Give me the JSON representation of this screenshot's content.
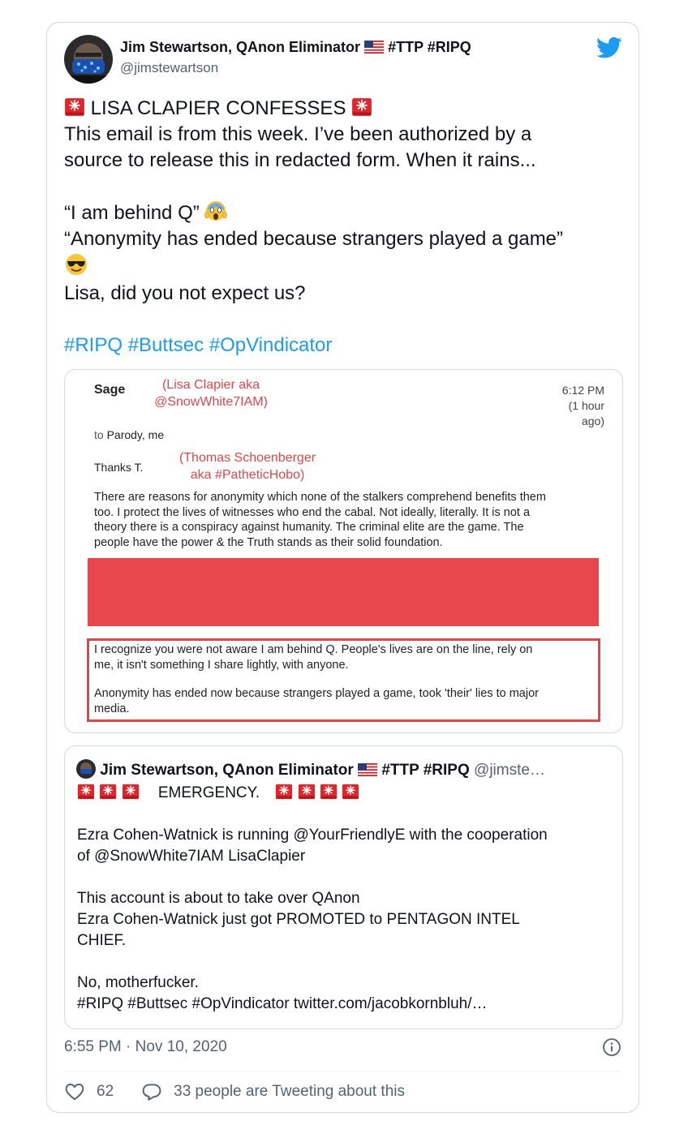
{
  "tweet": {
    "author_name": "Jim Stewartson, QAnon Eliminator",
    "name_suffix": "#TTP #RIPQ",
    "handle": "@jimstewartson",
    "title_line": "LISA CLAPIER CONFESSES",
    "body_lines": [
      "This email is from this week. I’ve been authorized by a",
      "source to release this in redacted form. When it rains..."
    ],
    "quote1": "“I am behind Q”",
    "quote2": "“Anonymity has ended because strangers played a game”",
    "closing": "Lisa, did you not expect us?",
    "hashtags": "#RIPQ #Buttsec #OpVindicator",
    "timestamp": "6:55 PM · Nov 10, 2020",
    "likes": "62",
    "retweet_text": "33 people are Tweeting about this"
  },
  "email": {
    "sender": "Sage",
    "sender_annotation_1": "(Lisa Clapier aka",
    "sender_annotation_2": "@SnowWhite7IAM)",
    "time": "6:12 PM",
    "ago_1": "(1 hour",
    "ago_2": "ago)",
    "to_prefix": "to",
    "to_names": "Parody, me",
    "greeting": "Thanks T.",
    "greeting_annotation_1": "(Thomas Schoenberger",
    "greeting_annotation_2": "aka #PatheticHobo)",
    "para1": [
      "There are reasons for anonymity which none of the stalkers comprehend benefits them",
      "too. I protect the lives of witnesses who end the cabal. Not ideally, literally. It is not a",
      "theory there is a conspiracy against humanity. The criminal elite are the game. The",
      "people have the power & the Truth stands as their solid foundation."
    ],
    "boxed_para1": [
      "I recognize you were not aware I am behind Q. People's lives are on the line, rely on",
      "me, it isn't something I share lightly, with anyone."
    ],
    "boxed_para2": [
      "Anonymity has ended now because strangers played a game, took 'their' lies to major",
      "media."
    ]
  },
  "quoted_tweet": {
    "author_name": "Jim Stewartson, QAnon Eliminator",
    "name_suffix": "#TTP #RIPQ",
    "handle": "@jimste…",
    "emergency": "EMERGENCY.",
    "lines_a": [
      "Ezra Cohen-Watnick is running @YourFriendlyE with the cooperation",
      "of @SnowWhite7IAM LisaClapier"
    ],
    "lines_b": [
      "This account is about to take over QAnon",
      "Ezra Cohen-Watnick just got PROMOTED to PENTAGON INTEL",
      "CHIEF."
    ],
    "line_c": "No, motherfucker.",
    "footer": "#RIPQ #Buttsec #OpVindicator twitter.com/jacobkornbluh/…"
  },
  "colors": {
    "accent": "#1d9bf0",
    "redaction": "#e8484d",
    "annotation_red": "#e0474c",
    "muted": "#536471"
  },
  "icons": [
    "avatar",
    "us-flag-icon",
    "twitter-bird-icon",
    "siren-icon",
    "scream-emoji-icon",
    "sunglasses-emoji-icon",
    "info-icon",
    "heart-icon",
    "reply-bubble-icon"
  ]
}
